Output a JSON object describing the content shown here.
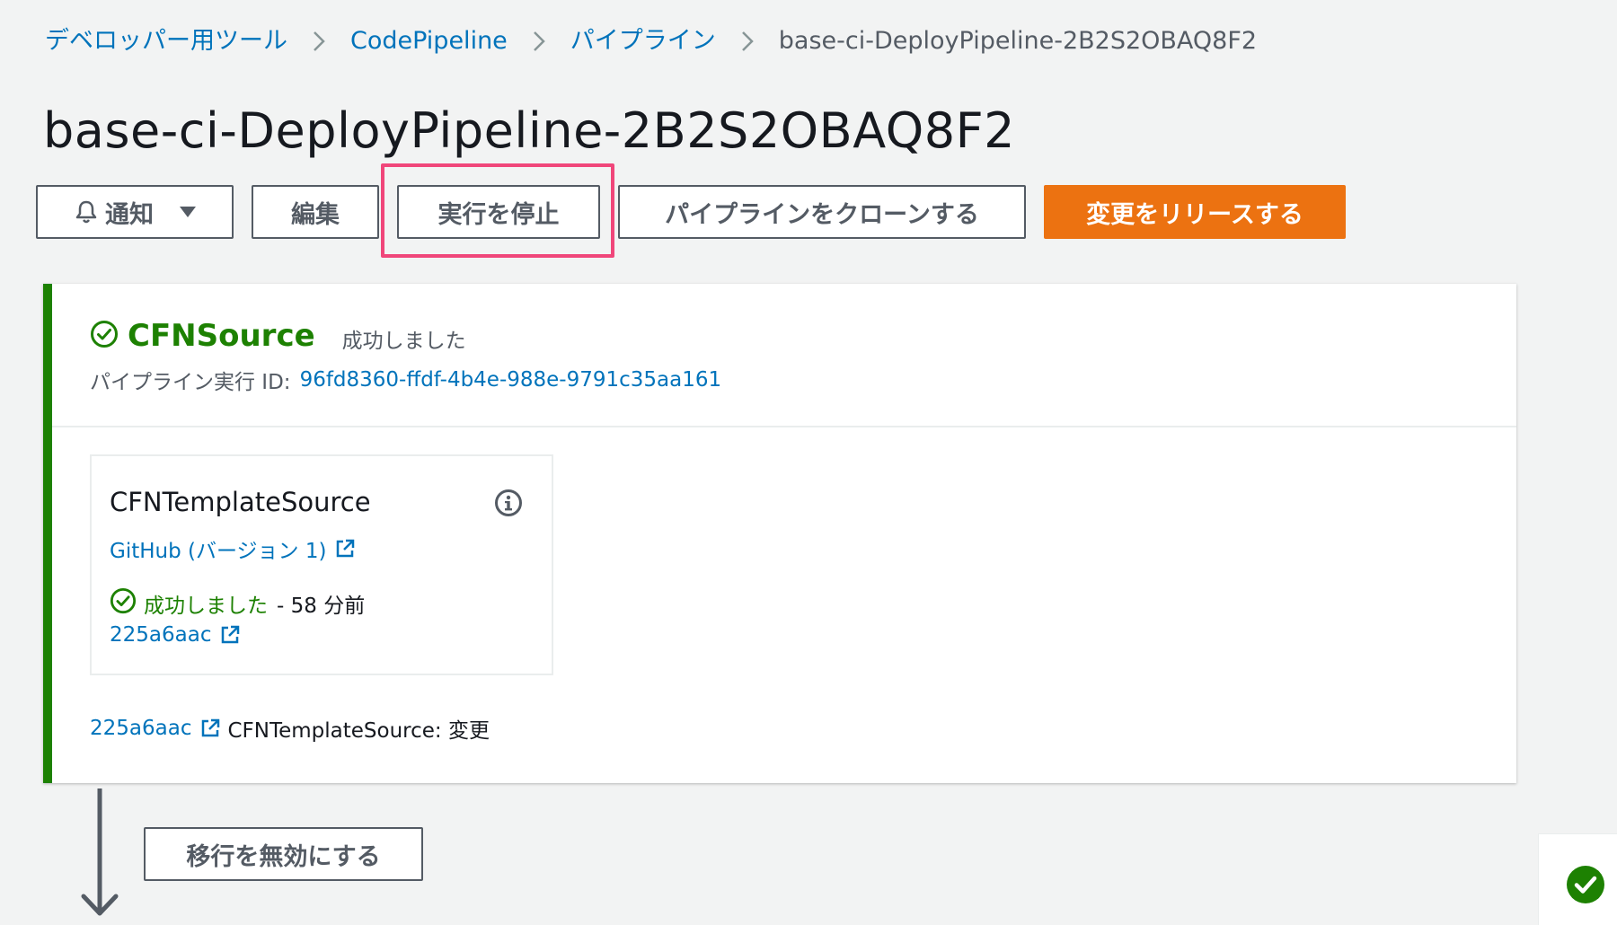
{
  "breadcrumb": {
    "items": [
      "デベロッパー用ツール",
      "CodePipeline",
      "パイプライン"
    ],
    "current": "base-ci-DeployPipeline-2B2S2OBAQ8F2"
  },
  "page": {
    "title": "base-ci-DeployPipeline-2B2S2OBAQ8F2"
  },
  "toolbar": {
    "notify_label": "通知",
    "edit_label": "編集",
    "stop_label": "実行を停止",
    "clone_label": "パイプラインをクローンする",
    "release_label": "変更をリリースする"
  },
  "stage": {
    "name": "CFNSource",
    "status": "成功しました",
    "exec_label": "パイプライン実行 ID:",
    "exec_id": "96fd8360-ffdf-4b4e-988e-9791c35aa161",
    "action": {
      "name": "CFNTemplateSource",
      "provider": "GitHub (バージョン 1)",
      "status": "成功しました",
      "time": "- 58 分前",
      "commit": "225a6aac"
    },
    "footer": {
      "revision": "225a6aac",
      "message": "CFNTemplateSource: 変更"
    }
  },
  "transition": {
    "disable_label": "移行を無効にする"
  },
  "colors": {
    "link": "#0073bb",
    "success": "#1d8102",
    "primary": "#ec7211",
    "highlight": "#f0467a"
  },
  "icons": [
    "chevron-right-icon",
    "bell-icon",
    "caret-down-icon",
    "check-circle-icon",
    "info-icon",
    "external-link-icon",
    "arrow-down-icon"
  ]
}
